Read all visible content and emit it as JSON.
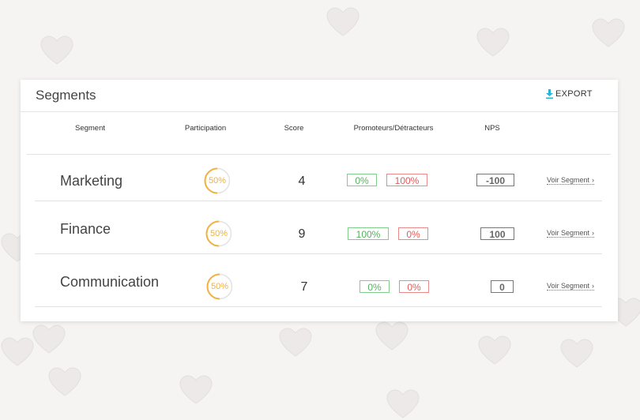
{
  "card": {
    "title": "Segments",
    "export_label": "EXPORT"
  },
  "table": {
    "headers": {
      "segment": "Segment",
      "participation": "Participation",
      "score": "Score",
      "promoteurs": "Promoteurs/Détracteurs",
      "nps": "NPS"
    },
    "rows": [
      {
        "name": "Marketing",
        "participation": "50%",
        "participation_fraction": 0.5,
        "score": "4",
        "promoteurs": "0%",
        "detracteurs": "100%",
        "nps": "-100",
        "link": "Voir Segment"
      },
      {
        "name": "Finance",
        "participation": "50%",
        "participation_fraction": 0.5,
        "score": "9",
        "promoteurs": "100%",
        "detracteurs": "0%",
        "nps": "100",
        "link": "Voir Segment"
      },
      {
        "name": "Communication",
        "participation": "50%",
        "participation_fraction": 0.5,
        "score": "7",
        "promoteurs": "0%",
        "detracteurs": "0%",
        "nps": "0",
        "link": "Voir Segment"
      }
    ]
  },
  "colors": {
    "ring": "#f0b13f",
    "promoteurs": "#52b25f",
    "detracteurs": "#e05b5b",
    "export_icon": "#2bb3d6"
  },
  "icons": {
    "export": "download-icon",
    "voir": "chevron-right-icon"
  }
}
